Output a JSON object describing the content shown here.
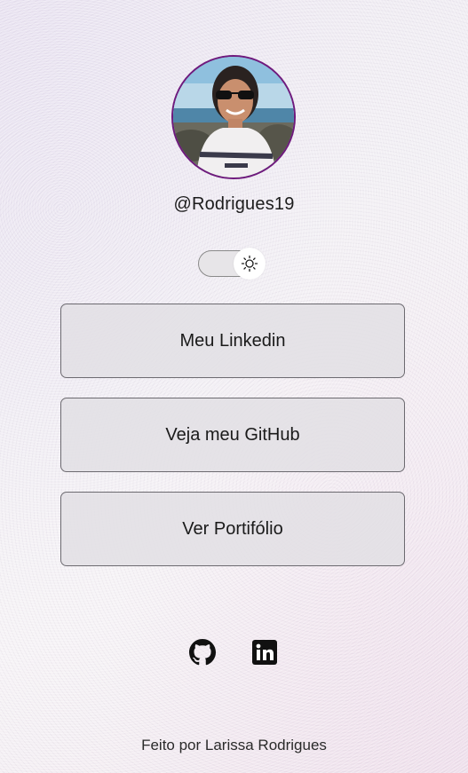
{
  "profile": {
    "handle": "@Rodrigues19"
  },
  "theme_toggle": {
    "state": "light",
    "icon": "sun-icon"
  },
  "links": [
    {
      "label": "Meu Linkedin"
    },
    {
      "label": "Veja meu GitHub"
    },
    {
      "label": "Ver Portifólio"
    }
  ],
  "social": {
    "github_icon": "github-icon",
    "linkedin_icon": "linkedin-icon"
  },
  "footer": {
    "text": "Feito por Larissa Rodrigues"
  },
  "colors": {
    "avatar_border": "#6f1a7d",
    "button_border": "#6c6a70",
    "button_bg": "#e2dfe4"
  }
}
